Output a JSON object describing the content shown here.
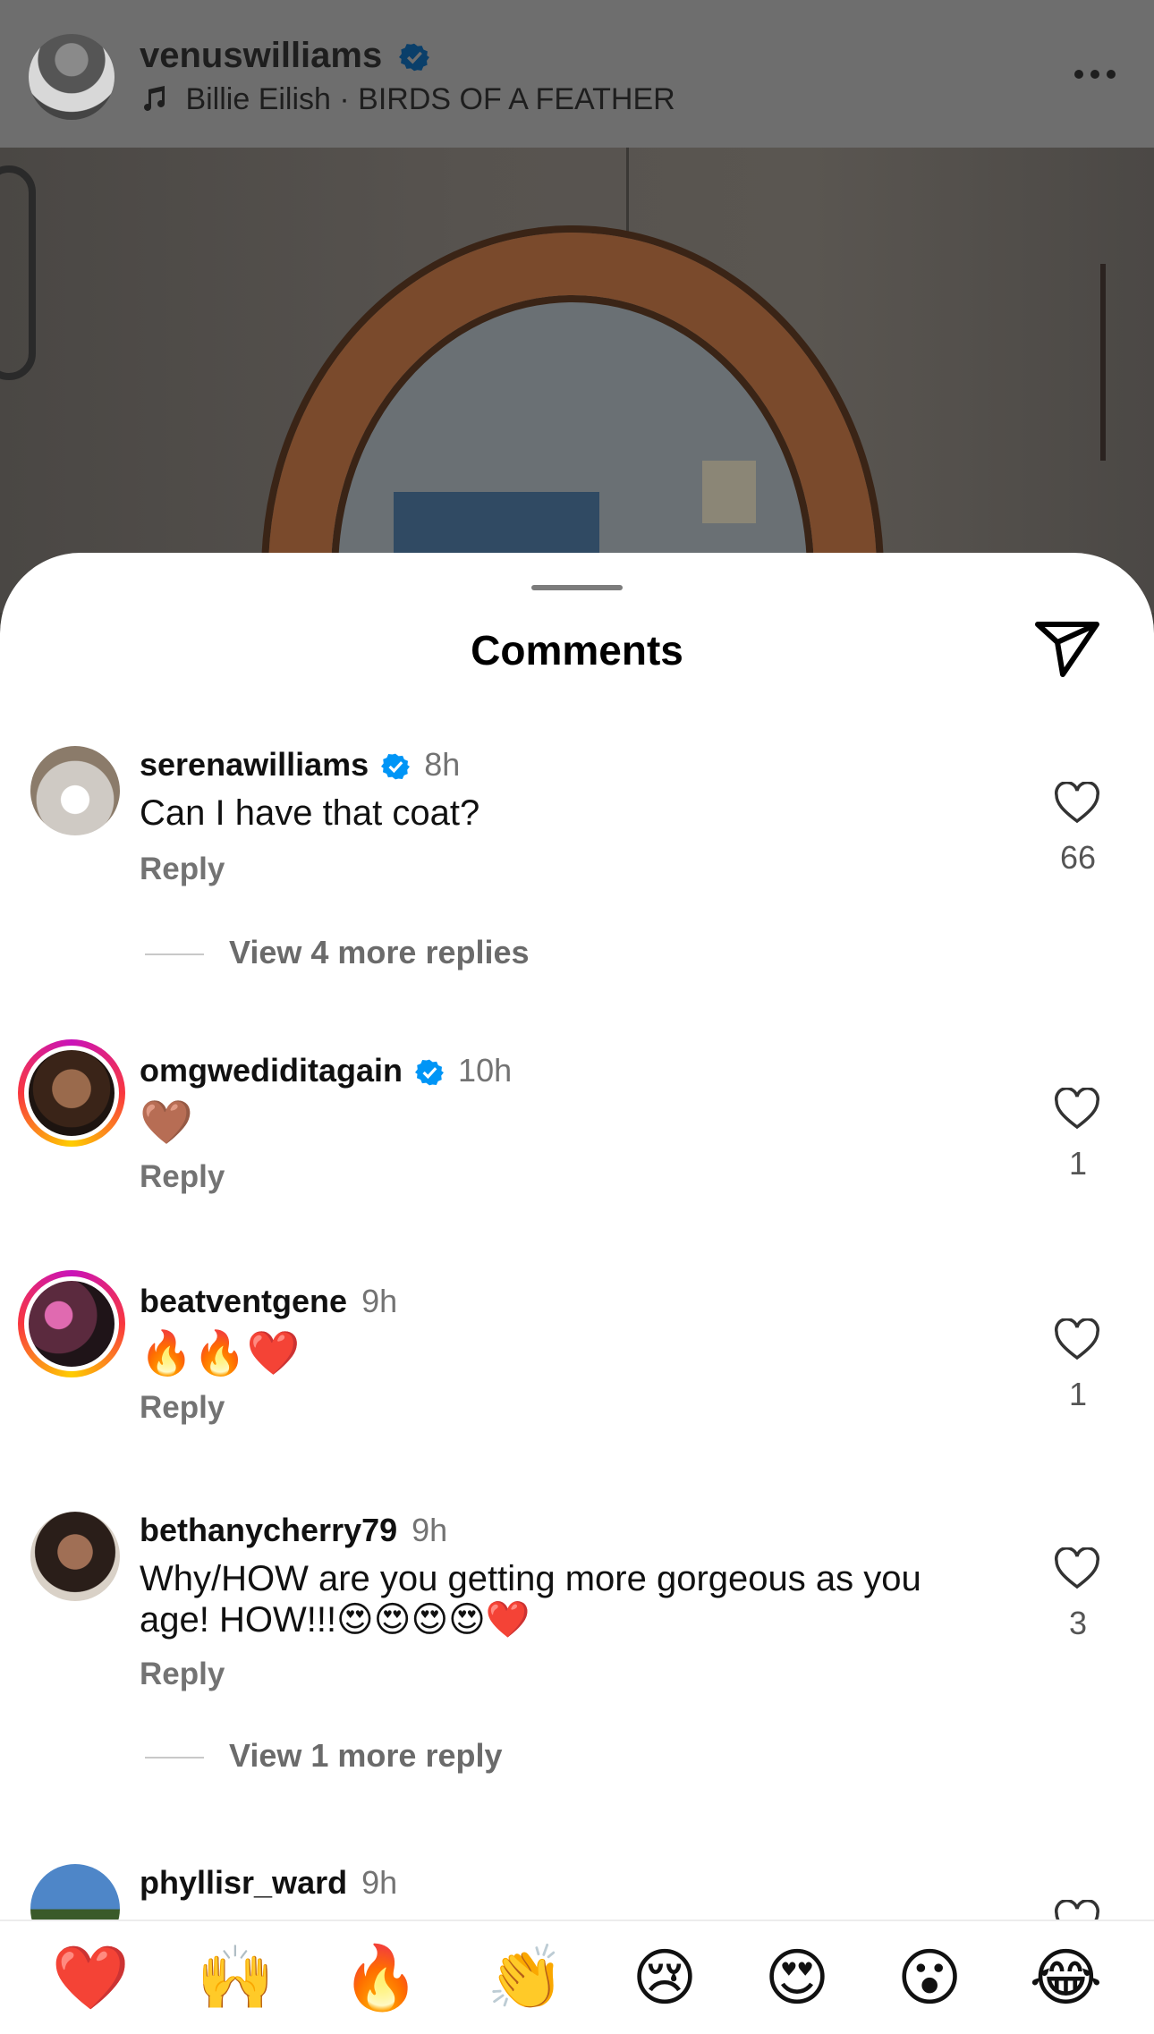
{
  "post": {
    "username": "venuswilliams",
    "music": "Billie Eilish · BIRDS OF A FEATHER"
  },
  "sheet": {
    "title": "Comments"
  },
  "comments": [
    {
      "username": "serenawilliams",
      "time": "8h",
      "text": "Can I have that coat?",
      "reply": "Reply",
      "likes": "66",
      "view_more": "View 4 more replies"
    },
    {
      "username": "omgwediditagain",
      "time": "10h",
      "text": "🤎",
      "reply": "Reply",
      "likes": "1"
    },
    {
      "username": "beatventgene",
      "time": "9h",
      "text": "🔥🔥❤️",
      "reply": "Reply",
      "likes": "1"
    },
    {
      "username": "bethanycherry79",
      "time": "9h",
      "text": "Why/HOW are you getting more gorgeous as you age! HOW!!!😍😍😍😍❤️",
      "reply": "Reply",
      "likes": "3",
      "view_more": "View 1 more reply"
    },
    {
      "username": "phyllisr_ward",
      "time": "9h"
    }
  ],
  "reactions": [
    "❤️",
    "🙌",
    "🔥",
    "👏",
    "😢",
    "😍",
    "😮",
    "😂"
  ],
  "colors": {
    "verified": "#0095f6",
    "secondary_text": "#737373",
    "story_ring": [
      "#c913b9",
      "#f9373f",
      "#fecd00"
    ]
  }
}
